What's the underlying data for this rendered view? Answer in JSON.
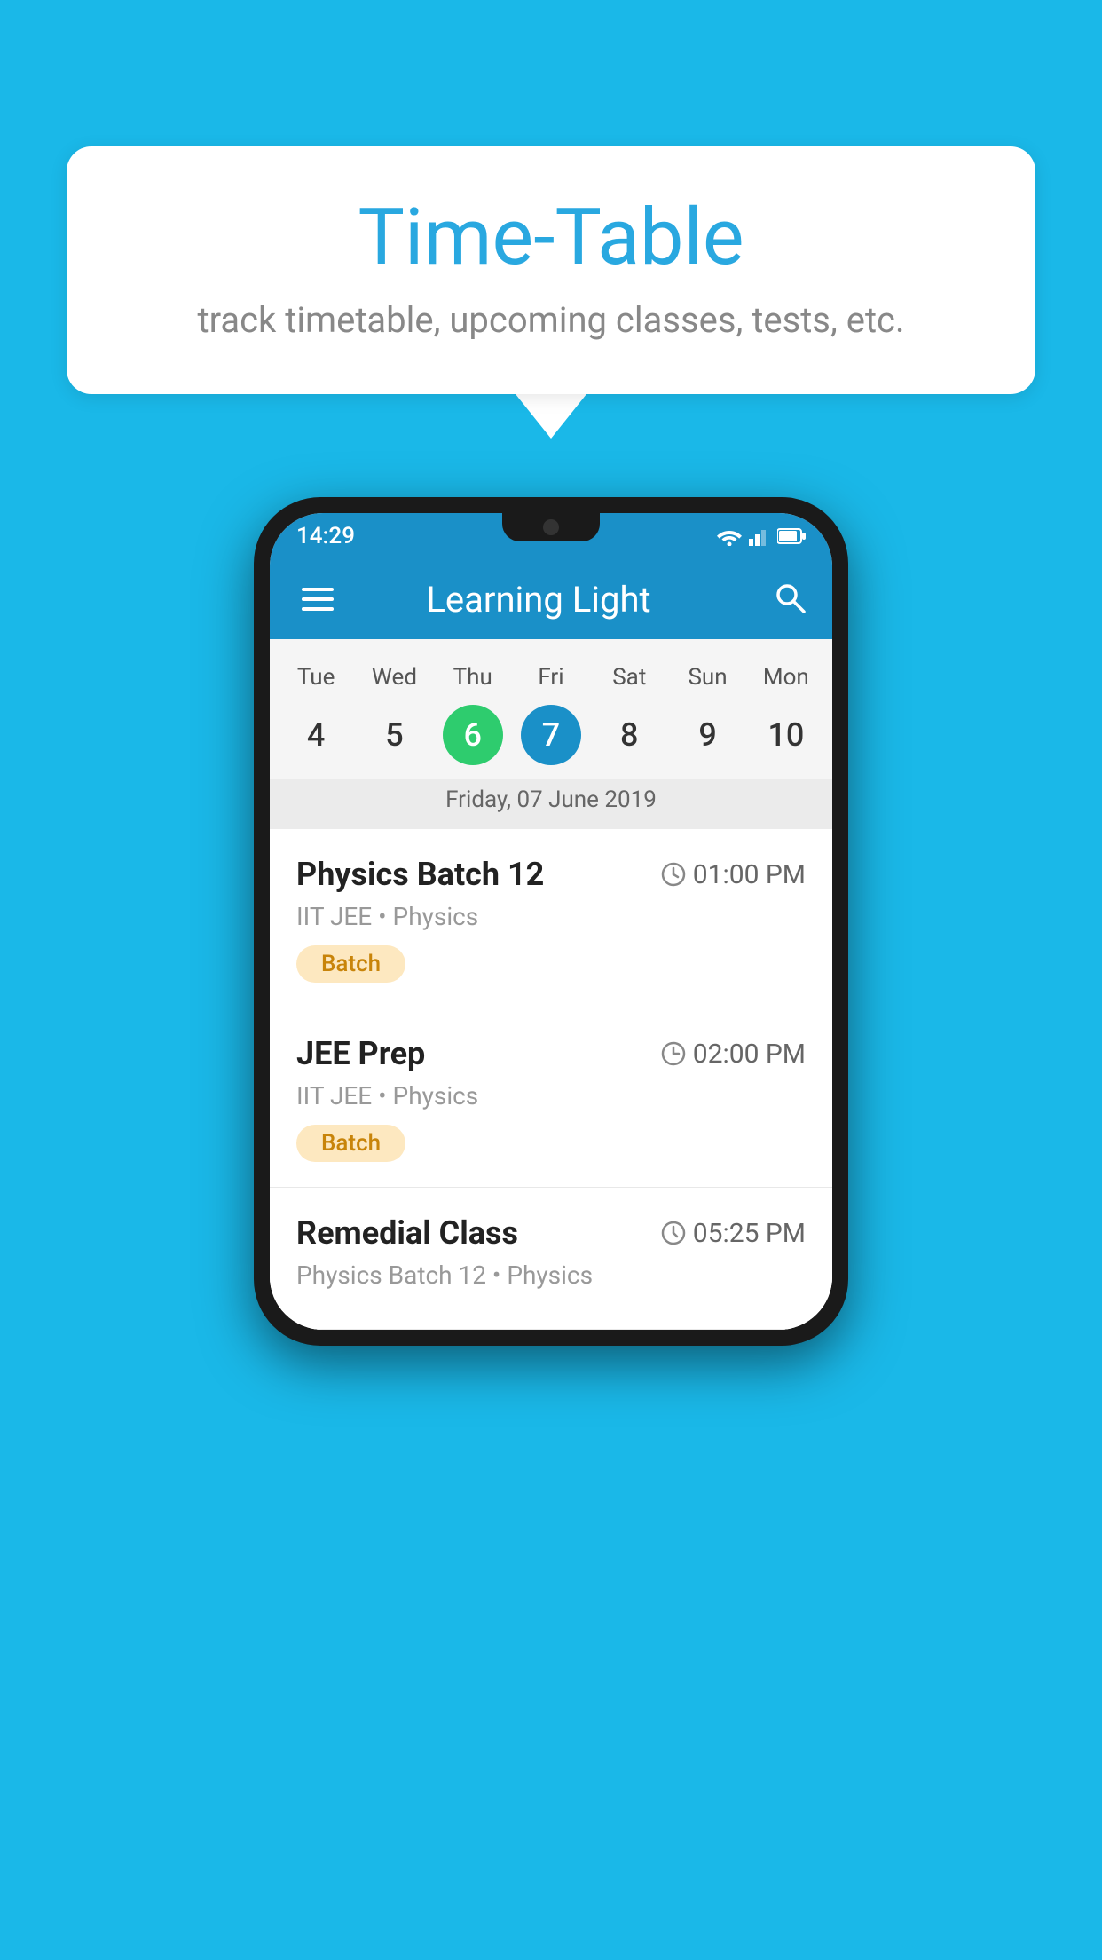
{
  "background_color": "#1ab8e8",
  "speech_bubble": {
    "title": "Time-Table",
    "subtitle": "track timetable, upcoming classes, tests, etc."
  },
  "phone": {
    "status_bar": {
      "time": "14:29"
    },
    "app_bar": {
      "title": "Learning Light"
    },
    "calendar": {
      "days": [
        {
          "label": "Tue",
          "number": "4"
        },
        {
          "label": "Wed",
          "number": "5"
        },
        {
          "label": "Thu",
          "number": "6",
          "state": "today"
        },
        {
          "label": "Fri",
          "number": "7",
          "state": "selected"
        },
        {
          "label": "Sat",
          "number": "8"
        },
        {
          "label": "Sun",
          "number": "9"
        },
        {
          "label": "Mon",
          "number": "10"
        }
      ],
      "selected_date": "Friday, 07 June 2019"
    },
    "schedule": [
      {
        "title": "Physics Batch 12",
        "time": "01:00 PM",
        "subtitle": "IIT JEE • Physics",
        "tag": "Batch"
      },
      {
        "title": "JEE Prep",
        "time": "02:00 PM",
        "subtitle": "IIT JEE • Physics",
        "tag": "Batch"
      },
      {
        "title": "Remedial Class",
        "time": "05:25 PM",
        "subtitle": "Physics Batch 12 • Physics",
        "tag": ""
      }
    ]
  },
  "icons": {
    "hamburger": "☰",
    "search": "🔍",
    "clock": "🕐"
  }
}
